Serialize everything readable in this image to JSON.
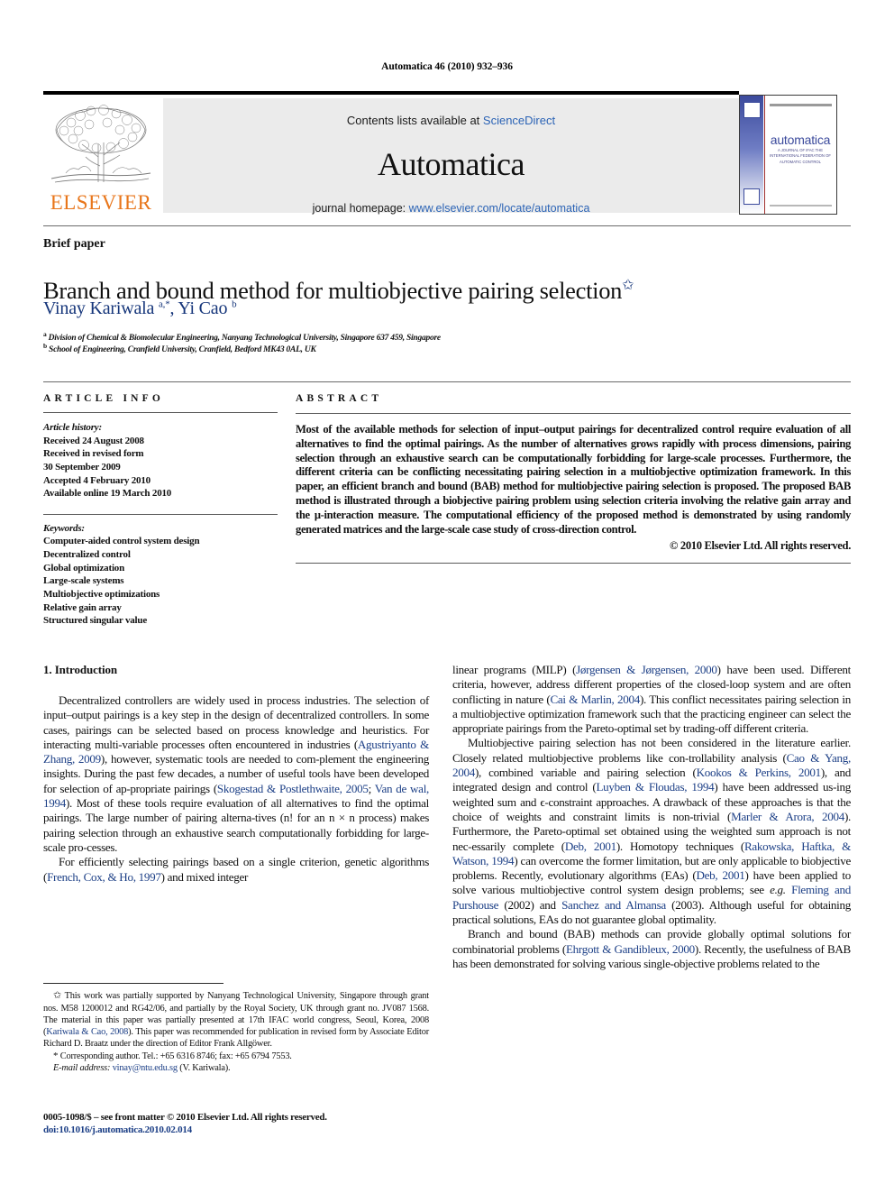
{
  "running_head": "Automatica 46 (2010) 932–936",
  "masthead": {
    "contents_prefix": "Contents lists available at ",
    "contents_link": "ScienceDirect",
    "journal_title": "Automatica",
    "homepage_prefix": "journal homepage: ",
    "homepage_url": "www.elsevier.com/locate/automatica",
    "publisher_wordmark": "ELSEVIER",
    "cover": {
      "word": "automatica",
      "subtitle": "A JOURNAL OF IFAC THE INTERNATIONAL FEDERATION OF AUTOMATIC CONTROL"
    }
  },
  "article": {
    "type_label": "Brief paper",
    "title": "Branch and bound method for multiobjective pairing selection",
    "title_marker": "✩",
    "authors_html": "Vinay Kariwala <sup>a,</sup><sup>*</sup>, Yi Cao <sup>b</sup>",
    "affiliation_a": "Division of Chemical & Biomolecular Engineering, Nanyang Technological University, Singapore 637 459, Singapore",
    "affiliation_b": "School of Engineering, Cranfield University, Cranfield, Bedford MK43 0AL, UK"
  },
  "info": {
    "heading": "ARTICLE INFO",
    "history_label": "Article history:",
    "history": [
      "Received 24 August 2008",
      "Received in revised form",
      "30 September 2009",
      "Accepted 4 February 2010",
      "Available online 19 March 2010"
    ],
    "keywords_label": "Keywords:",
    "keywords": [
      "Computer-aided control system design",
      "Decentralized control",
      "Global optimization",
      "Large-scale systems",
      "Multiobjective optimizations",
      "Relative gain array",
      "Structured singular value"
    ]
  },
  "abstract": {
    "heading": "ABSTRACT",
    "text": "Most of the available methods for selection of input–output pairings for decentralized control require evaluation of all alternatives to find the optimal pairings. As the number of alternatives grows rapidly with process dimensions, pairing selection through an exhaustive search can be computationally forbidding for large-scale processes. Furthermore, the different criteria can be conflicting necessitating pairing selection in a multiobjective optimization framework. In this paper, an efficient branch and bound (BAB) method for multiobjective pairing selection is proposed. The proposed BAB method is illustrated through a biobjective pairing problem using selection criteria involving the relative gain array and the μ-interaction measure. The computational efficiency of the proposed method is demonstrated by using randomly generated matrices and the large-scale case study of cross-direction control.",
    "copyright": "© 2010 Elsevier Ltd. All rights reserved."
  },
  "body": {
    "section_title": "1. Introduction",
    "left_paragraphs": [
      "Decentralized controllers are widely used in process industries. The selection of input–output pairings is a key step in the design of decentralized controllers. In some cases, pairings can be selected based on process knowledge and heuristics. For interacting multivariable processes often encountered in industries (Agustriyanto & Zhang, 2009), however, systematic tools are needed to complement the engineering insights. During the past few decades, a number of useful tools have been developed for selection of appropriate pairings (Skogestad & Postlethwaite, 2005; Van de wal, 1994). Most of these tools require evaluation of all alternatives to find the optimal pairings. The large number of pairing alternatives (n! for an n × n process) makes pairing selection through an exhaustive search computationally forbidding for large-scale processes.",
      "For efficiently selecting pairings based on a single criterion, genetic algorithms (French, Cox, & Ho, 1997) and mixed integer"
    ],
    "right_paragraphs": [
      "linear programs (MILP) (Jørgensen & Jørgensen, 2000) have been used. Different criteria, however, address different properties of the closed-loop system and are often conflicting in nature (Cai & Marlin, 2004). This conflict necessitates pairing selection in a multiobjective optimization framework such that the practicing engineer can select the appropriate pairings from the Pareto-optimal set by trading-off different criteria.",
      "Multiobjective pairing selection has not been considered in the literature earlier. Closely related multiobjective problems like controllability analysis (Cao & Yang, 2004), combined variable and pairing selection (Kookos & Perkins, 2001), and integrated design and control (Luyben & Floudas, 1994) have been addressed using weighted sum and ε-constraint approaches. A drawback of these approaches is that the choice of weights and constraint limits is non-trivial (Marler & Arora, 2004). Furthermore, the Pareto-optimal set obtained using the weighted sum approach is not necessarily complete (Deb, 2001). Homotopy techniques (Rakowska, Haftka, & Watson, 1994) can overcome the former limitation, but are only applicable to biobjective problems. Recently, evolutionary algorithms (EAs) (Deb, 2001) have been applied to solve various multiobjective control system design problems; see e.g. Fleming and Purshouse (2002) and Sanchez and Almansa (2003). Although useful for obtaining practical solutions, EAs do not guarantee global optimality.",
      "Branch and bound (BAB) methods can provide globally optimal solutions for combinatorial problems (Ehrgott & Gandibleux, 2000). Recently, the usefulness of BAB has been demonstrated for solving various single-objective problems related to the"
    ]
  },
  "footnotes": {
    "funding": "This work was partially supported by Nanyang Technological University, Singapore through grant nos. M58 1200012 and RG42/06, and partially by the Royal Society, UK through grant no. JV087 1568. The material in this paper was partially presented at 17th IFAC world congress, Seoul, Korea, 2008 (Kariwala & Cao, 2008). This paper was recommended for publication in revised form by Associate Editor Richard D. Braatz under the direction of Editor Frank Allgöwer.",
    "funding_ref": "Kariwala & Cao, 2008",
    "corresponding": "Corresponding author. Tel.: +65 6316 8746; fax: +65 6794 7553.",
    "email_label": "E-mail address:",
    "email": "vinay@ntu.edu.sg",
    "email_suffix": "(V. Kariwala)."
  },
  "imprint": {
    "issn_line": "0005-1098/$ – see front matter © 2010 Elsevier Ltd. All rights reserved.",
    "doi_label": "doi:",
    "doi": "10.1016/j.automatica.2010.02.014"
  },
  "colors": {
    "link": "#2b63b5",
    "reference": "#1c3f86",
    "author": "#15357a",
    "elsevier_orange": "#e8761b",
    "band": "#ebebeb"
  }
}
